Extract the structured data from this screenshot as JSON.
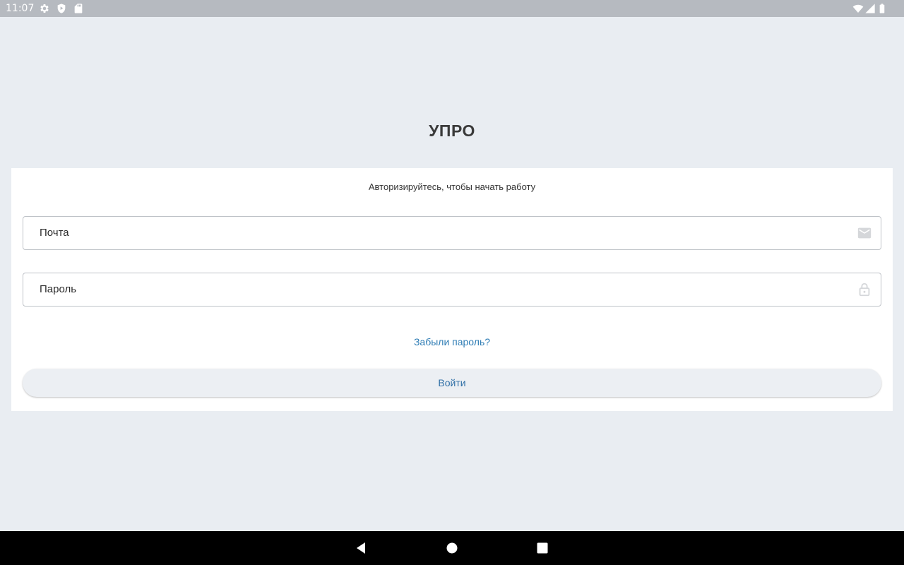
{
  "status_bar": {
    "time": "11:07",
    "left_icons": [
      "gear-icon",
      "shield-play-icon",
      "sd-card-icon"
    ],
    "right_icons": [
      "wifi-icon",
      "cellular-signal-icon",
      "battery-icon"
    ]
  },
  "app": {
    "title": "УПРО"
  },
  "login_card": {
    "subtitle": "Авторизируйтесь, чтобы начать работу",
    "email_field": {
      "placeholder": "Почта",
      "icon": "mail-icon"
    },
    "password_field": {
      "placeholder": "Пароль",
      "icon": "lock-icon"
    },
    "forgot_password_link": "Забыли пароль?",
    "login_button": "Войти"
  },
  "colors": {
    "background": "#e9edf2",
    "card": "#ffffff",
    "link": "#2f7db5",
    "button_text": "#2f6fa6",
    "status_bar": "#b6bac0",
    "nav_bar": "#000000"
  },
  "nav_bar": {
    "buttons": [
      "back-icon",
      "home-icon",
      "recents-icon"
    ]
  }
}
